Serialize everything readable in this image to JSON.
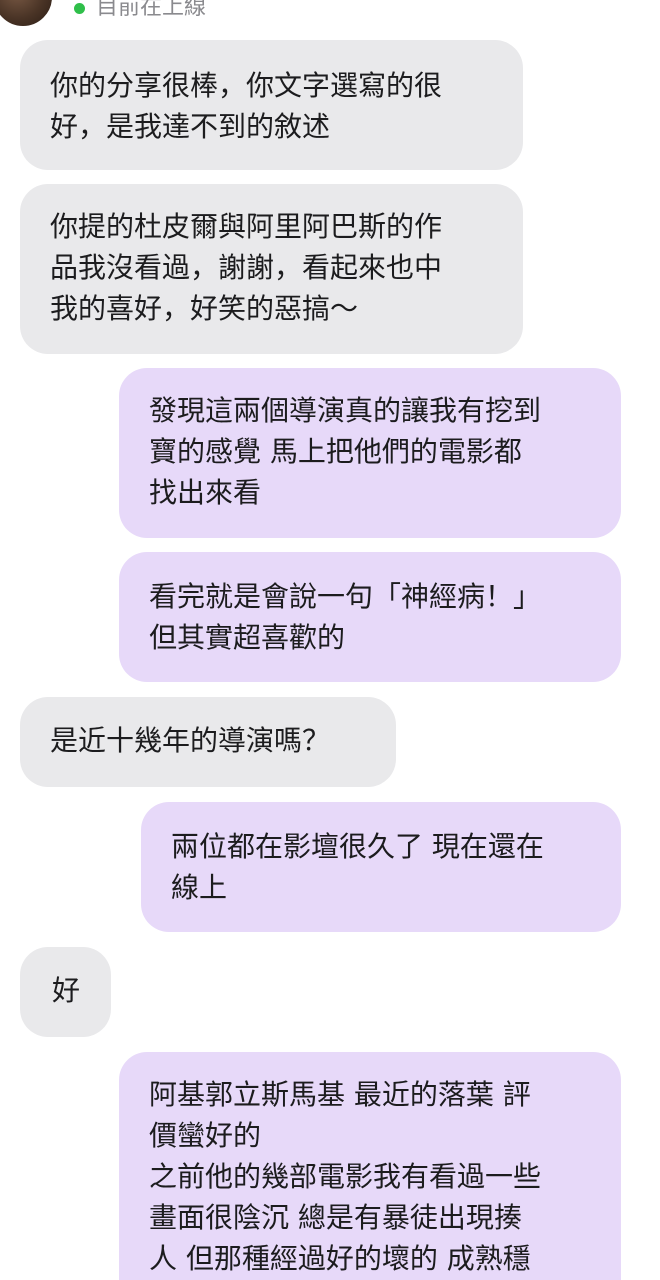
{
  "header": {
    "status_text": "目前在上線",
    "status_color": "#2fbf4a"
  },
  "colors": {
    "received_bubble": "#e9e9eb",
    "sent_bubble": "#e7d9f9",
    "text": "#1c1c1e"
  },
  "messages": [
    {
      "sender": "other",
      "text": "你的分享很棒，你文字選寫的很\n好，是我達不到的敘述"
    },
    {
      "sender": "other",
      "text": "你提的杜皮爾與阿里阿巴斯的作\n品我沒看過，謝謝，看起來也中\n我的喜好，好笑的惡搞～"
    },
    {
      "sender": "me",
      "text": "發現這兩個導演真的讓我有挖到\n寶的感覺 馬上把他們的電影都\n找出來看"
    },
    {
      "sender": "me",
      "text": "看完就是會說一句「神經病！」\n但其實超喜歡的"
    },
    {
      "sender": "other",
      "text": "是近十幾年的導演嗎？"
    },
    {
      "sender": "me",
      "text": "兩位都在影壇很久了 現在還在\n線上"
    },
    {
      "sender": "other",
      "text": "好"
    },
    {
      "sender": "me",
      "text": "阿基郭立斯馬基 最近的落葉 評\n價蠻好的\n之前他的幾部電影我有看過一些\n畫面很陰沉 總是有暴徒出現揍\n人 但那種經過好的壞的 成熟穩"
    }
  ]
}
